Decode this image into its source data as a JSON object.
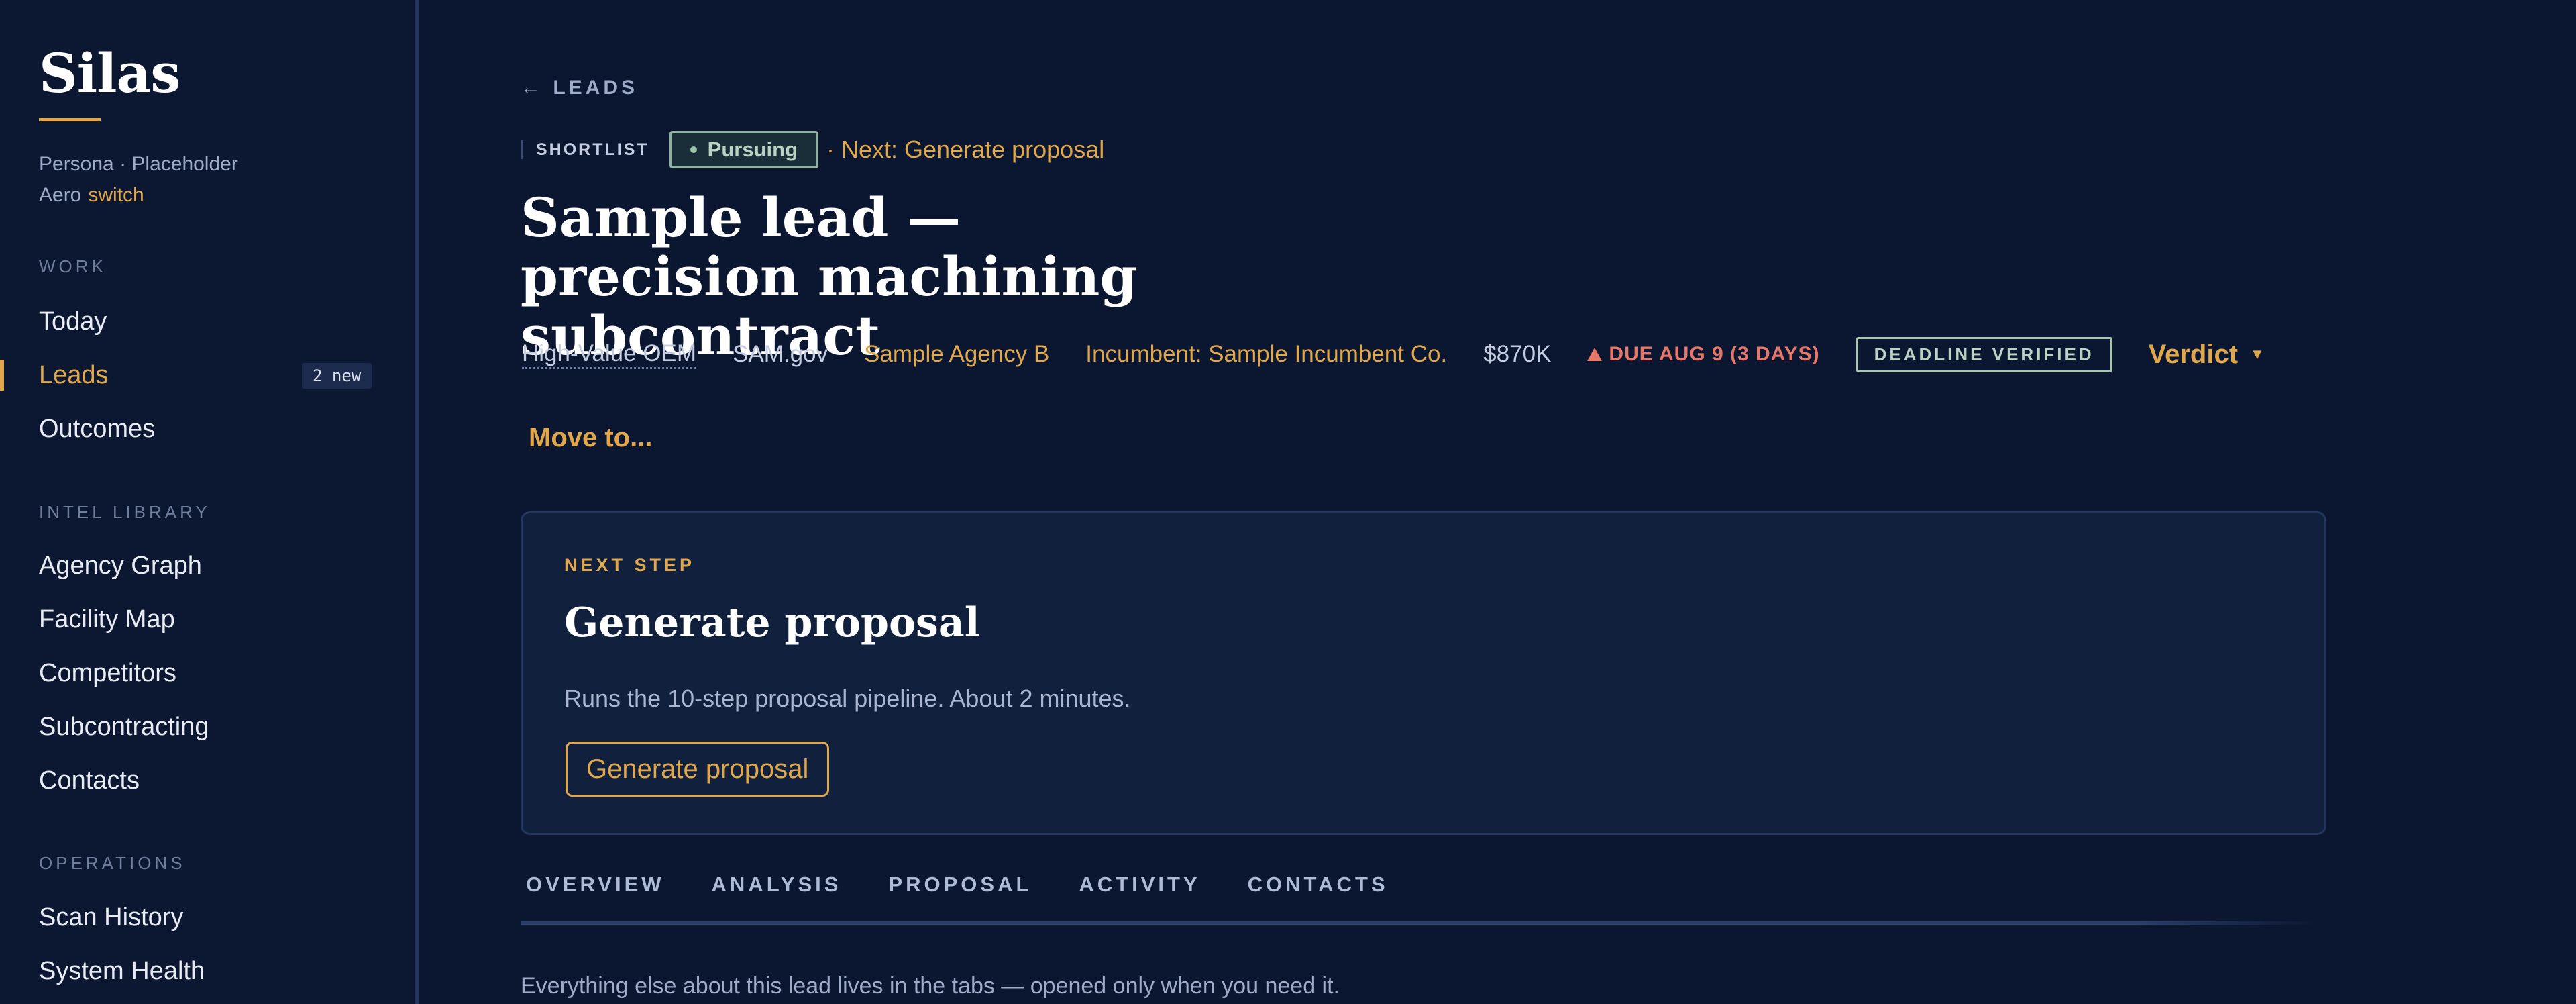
{
  "sidebar": {
    "brand": "Silas",
    "persona_line1": "Persona · Placeholder",
    "persona_line2": "Aero",
    "switch_label": "switch",
    "sections": {
      "work": "WORK",
      "intel": "INTEL LIBRARY",
      "operations": "OPERATIONS"
    },
    "items": {
      "today": "Today",
      "leads": "Leads",
      "leads_badge": "2 new",
      "outcomes": "Outcomes",
      "agency_graph": "Agency Graph",
      "facility_map": "Facility Map",
      "competitors": "Competitors",
      "subcontracting": "Subcontracting",
      "contacts": "Contacts",
      "scan_history": "Scan History",
      "system_health": "System Health"
    }
  },
  "main": {
    "back_label": "← LEADS",
    "stage": "SHORTLIST",
    "status": "Pursuing",
    "next_inline": "· Next: Generate proposal",
    "title": "Sample lead — precision machining subcontract",
    "meta": {
      "oem": "High-Value OEM",
      "source": "SAM.gov",
      "agency": "Sample Agency B",
      "incumbent": "Incumbent: Sample Incumbent Co.",
      "value": "$870K",
      "due": "DUE AUG 9 (3 DAYS)",
      "verified": "DEADLINE VERIFIED",
      "verdict": "Verdict"
    },
    "move_to": "Move to...",
    "next_step": {
      "label": "NEXT STEP",
      "title": "Generate proposal",
      "description": "Runs the 10-step proposal pipeline. About 2 minutes.",
      "button": "Generate proposal"
    },
    "tabs": [
      "OVERVIEW",
      "ANALYSIS",
      "PROPOSAL",
      "ACTIVITY",
      "CONTACTS"
    ],
    "footer_note": "Everything else about this lead lives in the tabs — opened only when you need it."
  },
  "colors": {
    "background": "#0b1630",
    "accent": "#e0a84a",
    "danger": "#e8776a",
    "success": "#8fb39a"
  }
}
